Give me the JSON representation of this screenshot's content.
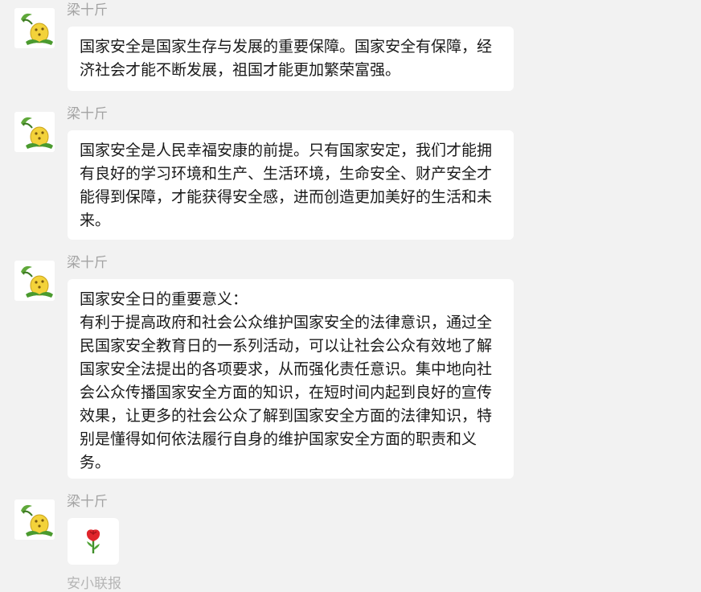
{
  "messages": [
    {
      "sender": "梁十斤",
      "paragraphs": [
        "国家安全是国家生存与发展的重要保障。国家安全有保障，经济社会才能不断发展，祖国才能更加繁荣富强。"
      ]
    },
    {
      "sender": "梁十斤",
      "paragraphs": [
        "国家安全是人民幸福安康的前提。只有国家安定，我们才能拥有良好的学习环境和生产、生活环境，生命安全、财产安全才能得到保障，才能获得安全感，进而创造更加美好的生活和未来。"
      ]
    },
    {
      "sender": "梁十斤",
      "paragraphs": [
        "国家安全日的重要意义：",
        "有利于提高政府和社会公众维护国家安全的法律意识，通过全民国家安全教育日的一系列活动，可以让社会公众有效地了解国家安全法提出的各项要求，从而强化责任意识。集中地向社会公众传播国家安全方面的知识，在短时间内起到良好的宣传效果，让更多的社会公众了解到国家安全方面的法律知识，特别是懂得如何依法履行自身的维护国家安全方面的职责和义务。"
      ]
    },
    {
      "sender": "梁十斤",
      "emoji": "rose-emoji"
    }
  ],
  "next_sender_partial": "安小联报"
}
